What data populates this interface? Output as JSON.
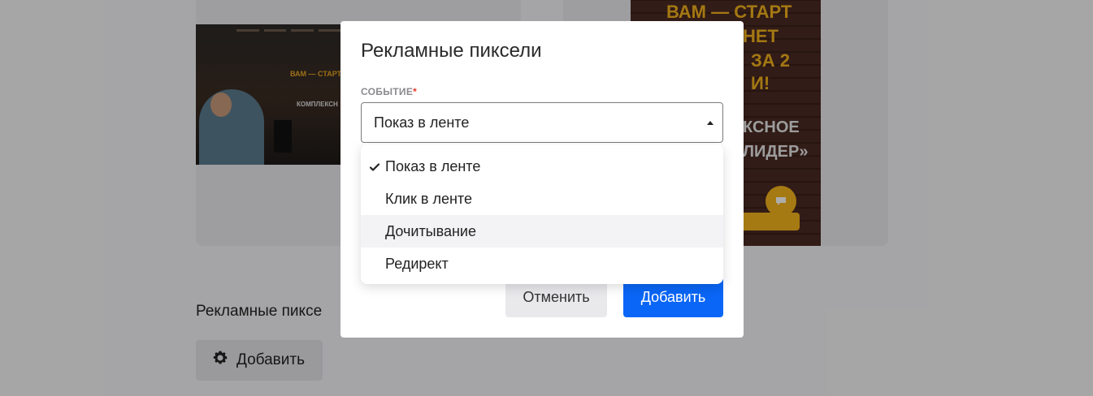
{
  "background": {
    "thumb_left": {
      "headline": "ВАМ — СТАРТ",
      "subline": "КОМПЛЕКСН"
    },
    "thumb_right": {
      "lines_yellow": [
        "ВАМ — СТАРТ",
        "НЕТ",
        "ЗА 2",
        "И!"
      ],
      "lines_white": [
        "КСНОЕ",
        "ЛИДЕР»"
      ]
    },
    "section_title": "Рекламные пиксе",
    "add_button_label": "Добавить"
  },
  "modal": {
    "title": "Рекламные пиксели",
    "field_label": "СОБЫТИЕ",
    "required_mark": "*",
    "selected_value": "Показ в ленте",
    "cancel_label": "Отменить",
    "add_label": "Добавить"
  },
  "dropdown": {
    "options": [
      {
        "label": "Показ в ленте",
        "selected": true
      },
      {
        "label": "Клик в ленте",
        "selected": false
      },
      {
        "label": "Дочитывание",
        "selected": false,
        "hovered": true
      },
      {
        "label": "Редирект",
        "selected": false
      }
    ]
  },
  "colors": {
    "primary": "#0a66f6",
    "required": "#e5372a",
    "accent_yellow": "#f3b41b"
  },
  "icons": {
    "add_button": "gear-icon",
    "select_caret": "caret-up-icon",
    "option_selected": "check-icon",
    "chat_bubble": "chat-icon"
  }
}
